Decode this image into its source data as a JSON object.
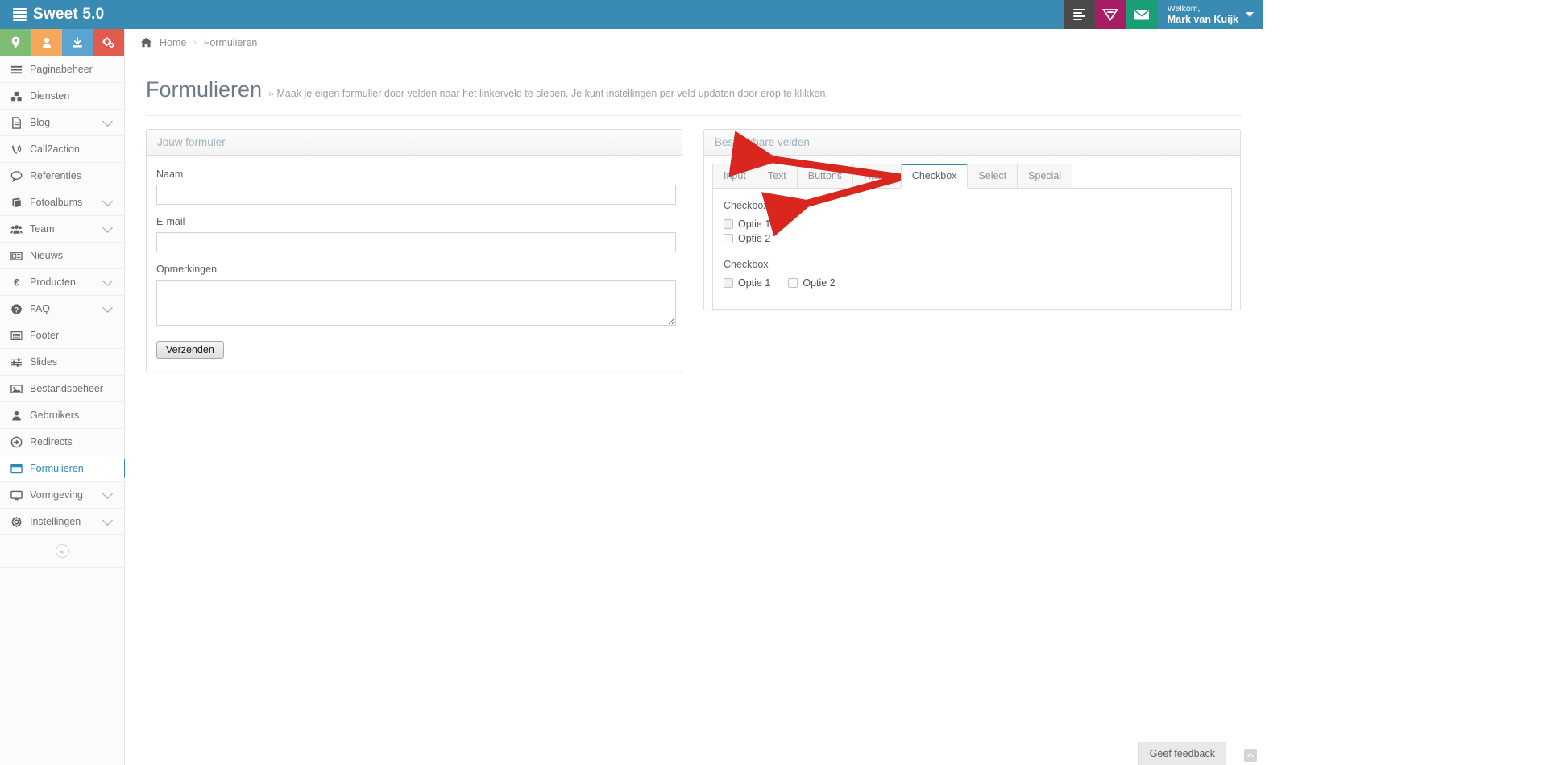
{
  "brand": {
    "title": "Sweet 5.0",
    "icon": "stacked-lines-icon"
  },
  "topbar": {
    "actions": [
      {
        "name": "notes-icon",
        "color": "#4a4a4a"
      },
      {
        "name": "superuser-badge-icon",
        "color": "#a81e64"
      },
      {
        "name": "mail-icon",
        "color": "#1a9e74"
      }
    ],
    "user": {
      "greeting": "Welkom,",
      "name": "Mark van Kuijk"
    }
  },
  "quick_actions": [
    {
      "name": "location-pin-icon",
      "color": "#7fbd72"
    },
    {
      "name": "user-icon",
      "color": "#f5a75a"
    },
    {
      "name": "download-icon",
      "color": "#5ba4cf"
    },
    {
      "name": "gears-icon",
      "color": "#e05c4e"
    }
  ],
  "breadcrumb": {
    "home": "Home",
    "separator": "›",
    "current": "Formulieren"
  },
  "sidebar": {
    "items": [
      {
        "label": "Paginabeheer",
        "icon": "hamburger-icon",
        "expandable": false,
        "active": false
      },
      {
        "label": "Diensten",
        "icon": "cubes-icon",
        "expandable": false,
        "active": false
      },
      {
        "label": "Blog",
        "icon": "file-text-icon",
        "expandable": true,
        "active": false
      },
      {
        "label": "Call2action",
        "icon": "phone-volume-icon",
        "expandable": false,
        "active": false
      },
      {
        "label": "Referenties",
        "icon": "comment-icon",
        "expandable": false,
        "active": false
      },
      {
        "label": "Fotoalbums",
        "icon": "book-icon",
        "expandable": true,
        "active": false
      },
      {
        "label": "Team",
        "icon": "users-icon",
        "expandable": true,
        "active": false
      },
      {
        "label": "Nieuws",
        "icon": "newspaper-icon",
        "expandable": false,
        "active": false
      },
      {
        "label": "Producten",
        "icon": "euro-icon",
        "expandable": true,
        "active": false
      },
      {
        "label": "FAQ",
        "icon": "question-circle-icon",
        "expandable": true,
        "active": false
      },
      {
        "label": "Footer",
        "icon": "list-icon",
        "expandable": false,
        "active": false
      },
      {
        "label": "Slides",
        "icon": "sliders-icon",
        "expandable": false,
        "active": false
      },
      {
        "label": "Bestandsbeheer",
        "icon": "image-icon",
        "expandable": false,
        "active": false
      },
      {
        "label": "Gebruikers",
        "icon": "user-icon",
        "expandable": false,
        "active": false
      },
      {
        "label": "Redirects",
        "icon": "arrow-circle-right-icon",
        "expandable": false,
        "active": false
      },
      {
        "label": "Formulieren",
        "icon": "window-icon",
        "expandable": false,
        "active": true
      },
      {
        "label": "Vormgeving",
        "icon": "desktop-icon",
        "expandable": true,
        "active": false
      },
      {
        "label": "Instellingen",
        "icon": "cog-icon",
        "expandable": true,
        "active": false
      }
    ],
    "collapse_label": "«"
  },
  "page": {
    "title": "Formulieren",
    "subtitle_marker": "»",
    "subtitle": "Maak je eigen formulier door velden naar het linkerveld te slepen. Je kunt instellingen per veld updaten door erop te klikken."
  },
  "form_panel": {
    "title": "Jouw formuler",
    "fields": [
      {
        "label": "Naam",
        "type": "text",
        "value": "",
        "placeholder": ""
      },
      {
        "label": "E-mail",
        "type": "text",
        "value": "",
        "placeholder": ""
      },
      {
        "label": "Opmerkingen",
        "type": "textarea",
        "value": "",
        "placeholder": ""
      }
    ],
    "submit_label": "Verzenden"
  },
  "fields_panel": {
    "title": "Beschikbare velden",
    "tabs": [
      {
        "label": "Input",
        "active": false
      },
      {
        "label": "Text",
        "active": false
      },
      {
        "label": "Buttons",
        "active": false
      },
      {
        "label": "Radio",
        "active": false
      },
      {
        "label": "Checkbox",
        "active": true
      },
      {
        "label": "Select",
        "active": false
      },
      {
        "label": "Special",
        "active": false
      }
    ],
    "groups": [
      {
        "title": "Checkbox",
        "layout": "stacked",
        "options": [
          {
            "label": "Optie 1",
            "checked": false
          },
          {
            "label": "Optie 2",
            "checked": false
          }
        ]
      },
      {
        "title": "Checkbox",
        "layout": "inline",
        "options": [
          {
            "label": "Optie 1",
            "checked": false
          },
          {
            "label": "Optie 2",
            "checked": false
          }
        ]
      }
    ]
  },
  "annotations": {
    "arrow_color": "#d9271f",
    "arrows": [
      {
        "name": "arrow-to-stacked-checkbox",
        "points": "from (1148,290) to (986,268)"
      },
      {
        "name": "arrow-to-inline-checkbox",
        "points": "from (1148,290) to (1026,322)"
      }
    ]
  },
  "feedback": {
    "label": "Geef feedback"
  },
  "scroll_top": {
    "label": "«"
  },
  "colors": {
    "brand_blue": "#3a8bb4",
    "active_blue": "#2c8ab9",
    "sidebar_bg": "#fbfbfb",
    "panel_border": "#dddddd",
    "arrow_red": "#d9271f"
  }
}
